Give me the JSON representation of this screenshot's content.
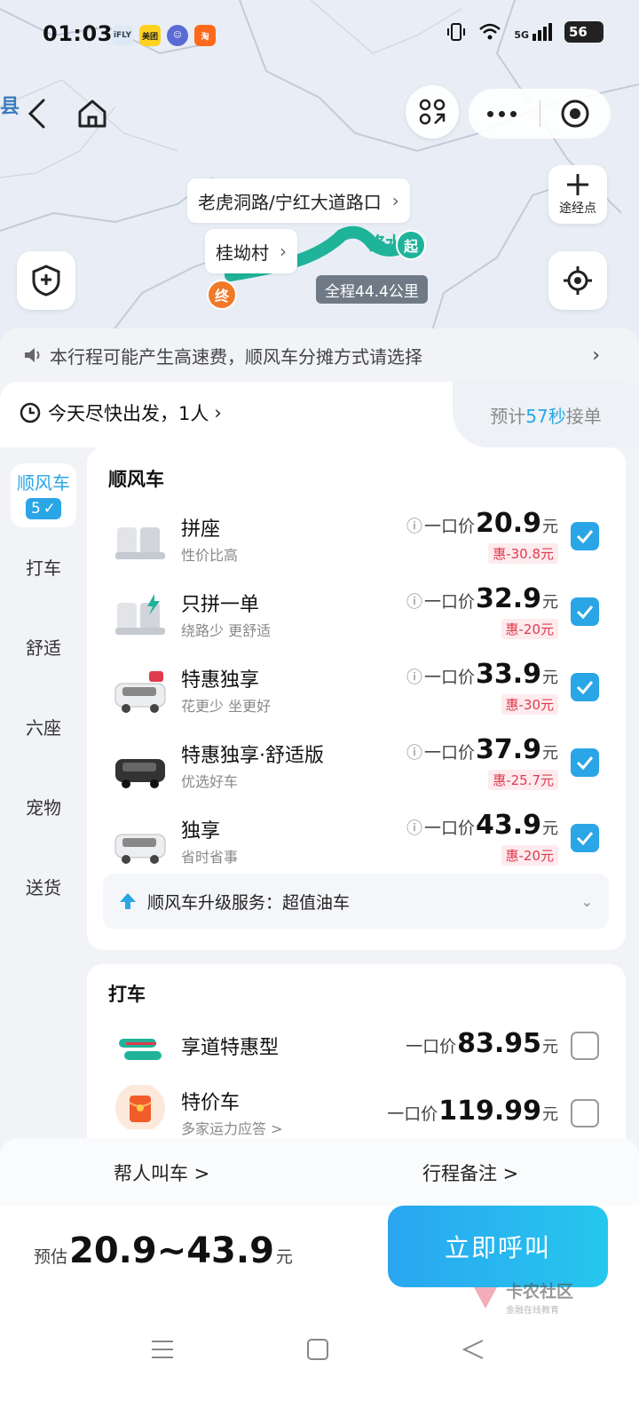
{
  "status": {
    "time": "01:03",
    "apps": [
      "iFLY",
      "美团",
      "☺",
      "淘"
    ],
    "network": "5G",
    "battery": "56"
  },
  "map": {
    "county_label": "县",
    "waypoint_label": "途经点",
    "route_start_label": "老虎洞路/宁红大道路口",
    "route_end_label": "桂坳村",
    "start_pin": "起",
    "end_pin": "终",
    "distance": "全程44.4公里",
    "road_text": "修水"
  },
  "notice": {
    "text": "本行程可能产生高速费，顺风车分摊方式请选择"
  },
  "departure": {
    "text": "今天尽快出发，1人",
    "eta_prefix": "预计",
    "eta_value": "57秒",
    "eta_suffix": "接单"
  },
  "tabs": [
    {
      "label": "顺风车",
      "badge": "5"
    },
    {
      "label": "打车"
    },
    {
      "label": "舒适"
    },
    {
      "label": "六座"
    },
    {
      "label": "宠物"
    },
    {
      "label": "送货"
    }
  ],
  "shunfeng": {
    "title": "顺风车",
    "price_prefix": "一口价",
    "unit": "元",
    "options": [
      {
        "name": "拼座",
        "sub": "性价比高",
        "price": "20.9",
        "discount": "惠-30.8元",
        "checked": true
      },
      {
        "name": "只拼一单",
        "sub": "绕路少 更舒适",
        "price": "32.9",
        "discount": "惠-20元",
        "checked": true
      },
      {
        "name": "特惠独享",
        "sub": "花更少 坐更好",
        "price": "33.9",
        "discount": "惠-30元",
        "checked": true
      },
      {
        "name": "特惠独享·舒适版",
        "sub": "优选好车",
        "price": "37.9",
        "discount": "惠-25.7元",
        "checked": true
      },
      {
        "name": "独享",
        "sub": "省时省事",
        "price": "43.9",
        "discount": "惠-20元",
        "checked": true
      }
    ],
    "upgrade": "顺风车升级服务：超值油车"
  },
  "taxi": {
    "title": "打车",
    "price_prefix": "一口价",
    "unit": "元",
    "options": [
      {
        "name": "享道特惠型",
        "sub": "",
        "price": "83.95",
        "checked": false
      },
      {
        "name": "特价车",
        "sub": "多家运力应答 >",
        "price": "119.99",
        "checked": false
      }
    ]
  },
  "helper": {
    "left": "帮人叫车 >",
    "right": "行程备注 >"
  },
  "estimate": {
    "prefix": "预估",
    "range": "20.9~43.9",
    "unit": "元"
  },
  "call_button": "立即呼叫",
  "watermark": {
    "title": "卡农社区",
    "sub": "金融在线教育"
  },
  "colors": {
    "accent": "#2aa5e6",
    "discount": "#e03a4d",
    "route": "#1fb39a",
    "end_pin": "#f07a2a"
  }
}
